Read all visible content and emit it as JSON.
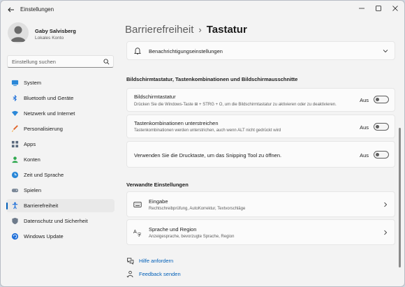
{
  "window": {
    "title": "Einstellungen"
  },
  "profile": {
    "name": "Gaby Salvisberg",
    "account": "Lokales Konto"
  },
  "search": {
    "placeholder": "Einstellung suchen"
  },
  "sidebar": {
    "items": [
      {
        "label": "System",
        "icon": "monitor-icon"
      },
      {
        "label": "Bluetooth und Geräte",
        "icon": "bluetooth-icon"
      },
      {
        "label": "Netzwerk und Internet",
        "icon": "wifi-icon"
      },
      {
        "label": "Personalisierung",
        "icon": "brush-icon"
      },
      {
        "label": "Apps",
        "icon": "apps-icon"
      },
      {
        "label": "Konten",
        "icon": "person-icon"
      },
      {
        "label": "Zeit und Sprache",
        "icon": "globe-clock-icon"
      },
      {
        "label": "Spielen",
        "icon": "gamepad-icon"
      },
      {
        "label": "Barrierefreiheit",
        "icon": "accessibility-icon",
        "active": true
      },
      {
        "label": "Datenschutz und Sicherheit",
        "icon": "shield-icon"
      },
      {
        "label": "Windows Update",
        "icon": "update-icon"
      }
    ]
  },
  "breadcrumb": {
    "parent": "Barrierefreiheit",
    "separator": "›",
    "current": "Tastatur"
  },
  "notifications_card": {
    "title": "Benachrichtigungseinstellungen"
  },
  "section1": {
    "heading": "Bildschirmtastatur, Tastenkombinationen und Bildschirmausschnitte"
  },
  "settings": [
    {
      "title": "Bildschirmtastatur",
      "desc": "Drücken Sie die Windows-Taste ⊞ + STRG + O, um die Bildschirmtastatur zu aktivieren oder zu deaktivieren.",
      "state": "Aus"
    },
    {
      "title": "Tastenkombinationen unterstreichen",
      "desc": "Tastenkombinationen werden unterstrichen, auch wenn ALT nicht gedrückt wird",
      "state": "Aus"
    },
    {
      "title": "Verwenden Sie die Drucktaste, um das Snipping Tool zu öffnen.",
      "desc": "",
      "state": "Aus"
    }
  ],
  "section2": {
    "heading": "Verwandte Einstellungen"
  },
  "related": [
    {
      "title": "Eingabe",
      "desc": "Rechtschreibprüfung, AutoKorrektur, Textvorschläge"
    },
    {
      "title": "Sprache und Region",
      "desc": "Anzeigesprache, bevorzugte Sprache, Region"
    }
  ],
  "links": {
    "help": "Hilfe anfordern",
    "feedback": "Feedback senden"
  },
  "colors": {
    "accent": "#005fb8",
    "background": "#f3f3f3",
    "card": "#fbfbfb"
  }
}
